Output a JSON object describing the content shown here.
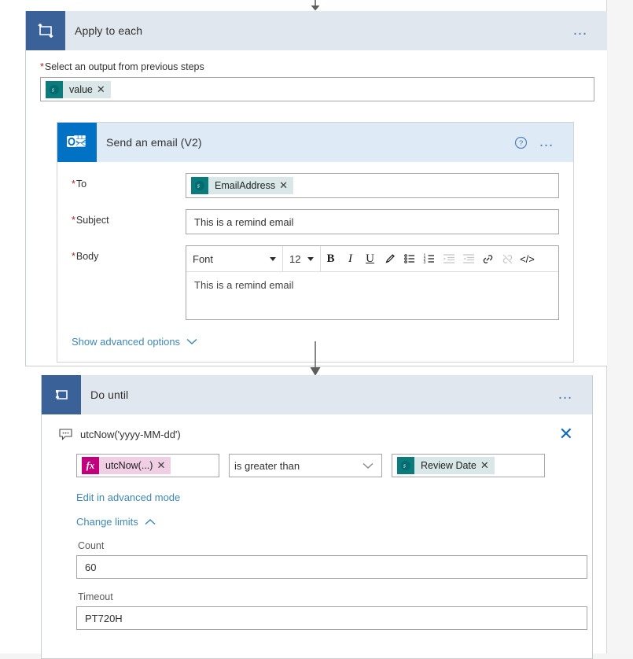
{
  "apply_to_each": {
    "title": "Apply to each",
    "icon": "loop-icon",
    "menu": "…",
    "output_label": "Select an output from previous steps",
    "output_token": {
      "text": "value",
      "icon": "sharepoint-icon",
      "remove": "✕"
    }
  },
  "email_card": {
    "title": "Send an email (V2)",
    "icon": "outlook-icon",
    "help": "?",
    "menu": "…",
    "to": {
      "label": "To",
      "token": {
        "text": "EmailAddress",
        "icon": "sharepoint-icon",
        "remove": "✕"
      }
    },
    "subject": {
      "label": "Subject",
      "value": "This is a remind email"
    },
    "body": {
      "label": "Body",
      "value": "This is a remind email",
      "toolbar": {
        "font": "Font",
        "size": "12",
        "bold": "B",
        "italic": "I",
        "underline": "U",
        "highlight": "✎",
        "bullet_list": "☰",
        "numbered_list": "☷",
        "indent": "→",
        "outdent": "←",
        "link": "🔗",
        "unlink": "⛓",
        "code": "</>"
      }
    },
    "advanced_options": "Show advanced options",
    "advanced_chevron": "chevron-down"
  },
  "do_until": {
    "title": "Do until",
    "icon": "dountil-icon",
    "menu": "…",
    "expression": "utcNow('yyyy-MM-dd')",
    "expression_icon": "comment-icon",
    "close": "✕",
    "condition": {
      "left_token": {
        "text": "utcNow(...)",
        "icon": "fx-icon",
        "remove": "✕"
      },
      "operator": "is greater than",
      "right_token": {
        "text": "Review Date",
        "icon": "sharepoint-icon",
        "remove": "✕"
      }
    },
    "advanced_mode_link": "Edit in advanced mode",
    "change_limits_link": "Change limits",
    "change_limits_chevron": "chevron-up",
    "count": {
      "label": "Count",
      "value": "60"
    },
    "timeout": {
      "label": "Timeout",
      "value": "PT720H"
    }
  },
  "colors": {
    "scope_header": "#e1e7ee",
    "email_header": "#deeaf6",
    "loop_tile": "#3a6298",
    "outlook_tile": "#0072c6",
    "sharepoint_token": "#0b7b7b",
    "fx_token": "#c2007b",
    "link": "#0078d4",
    "required_star": "#a4262c"
  }
}
